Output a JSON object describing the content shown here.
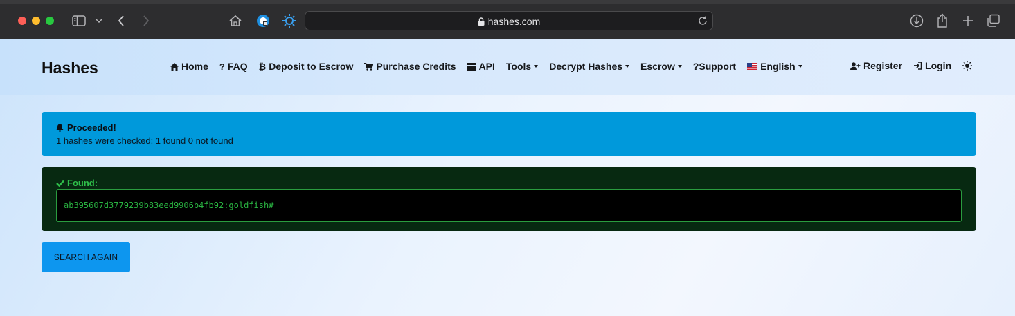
{
  "browser": {
    "url": "hashes.com"
  },
  "site": {
    "brand": "Hashes",
    "nav": [
      {
        "label": "Home"
      },
      {
        "label": "FAQ"
      },
      {
        "label": "Deposit to Escrow"
      },
      {
        "label": "Purchase Credits"
      },
      {
        "label": "API"
      },
      {
        "label": "Tools"
      },
      {
        "label": "Decrypt Hashes"
      },
      {
        "label": "Escrow"
      },
      {
        "label": "Support"
      },
      {
        "label": "English"
      }
    ],
    "auth": {
      "register": "Register",
      "login": "Login"
    }
  },
  "alert": {
    "title": "Proceeded!",
    "message": "1 hashes were checked: 1 found 0 not found"
  },
  "found": {
    "title": "Found:",
    "result": "ab395607d3779239b83eed9906b4fb92:goldfish#"
  },
  "actions": {
    "search_again": "SEARCH AGAIN"
  },
  "colors": {
    "info_alert": "#0099db",
    "found_bg": "#072911",
    "found_text": "#2fbf4a",
    "button": "#0d96ef"
  }
}
